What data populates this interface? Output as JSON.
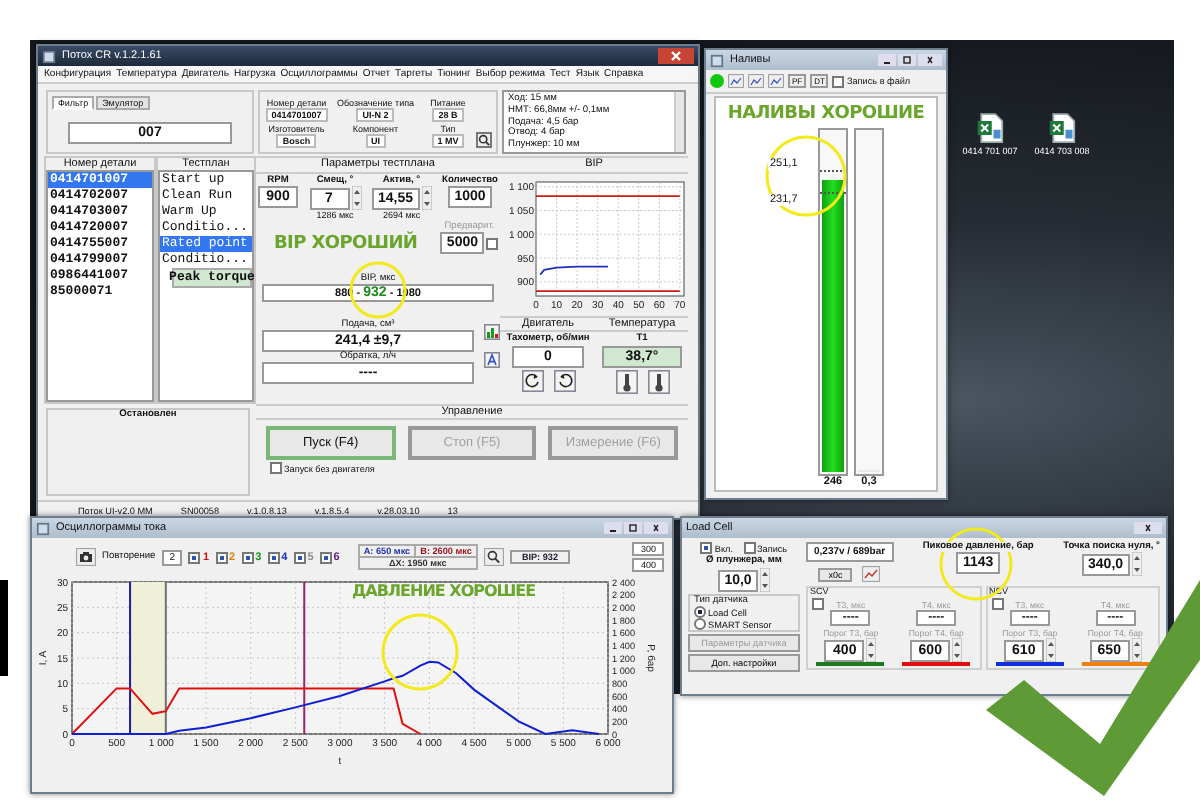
{
  "desktop": {
    "icons": [
      {
        "label": "0414 701 007"
      },
      {
        "label": "0414 703 008"
      }
    ]
  },
  "main": {
    "title": "Потох CR v.1.2.1.61",
    "menu": [
      "Конфигурация",
      "Температура",
      "Двигатель",
      "Нагрузка",
      "Осциллограммы",
      "Отчет",
      "Таргеты",
      "Тюнинг",
      "Выбор режима",
      "Тест",
      "Язык",
      "Справка"
    ],
    "tabs": [
      {
        "label": "Фильтр",
        "selected": true
      },
      {
        "label": "Эмулятор",
        "selected": false
      }
    ],
    "filter": {
      "value": "007"
    },
    "info": [
      {
        "label": "Номер детали",
        "value": "0414701007"
      },
      {
        "label": "Обозначение типа",
        "value": "UI-N 2"
      },
      {
        "label": "Питание",
        "value": "28 В"
      },
      {
        "label": "Изготовитель",
        "value": "Bosch"
      },
      {
        "label": "Компонент",
        "value": "UI"
      },
      {
        "label": "Тип",
        "value": "1 MV"
      }
    ],
    "notes": [
      "Ход: 15 мм",
      "НМТ: 66,8мм +/- 0,1мм",
      "Подача: 4,5 бар",
      "Отвод: 4 бар",
      "Плунжер: 10 мм"
    ],
    "parts": {
      "header": "Номер детали",
      "items": [
        {
          "label": "0414701007",
          "selected": true
        },
        {
          "label": "0414702007",
          "selected": false
        },
        {
          "label": "0414703007",
          "selected": false
        },
        {
          "label": "0414720007",
          "selected": false
        },
        {
          "label": "0414755007",
          "selected": false
        },
        {
          "label": "0414799007",
          "selected": false
        },
        {
          "label": "0986441007",
          "selected": false
        },
        {
          "label": "85000071",
          "selected": false
        }
      ]
    },
    "testplan": {
      "header": "Тестплан",
      "items": [
        {
          "label": "Start up",
          "selected": false,
          "current": false
        },
        {
          "label": "Clean Run",
          "selected": false,
          "current": false
        },
        {
          "label": "Warm Up",
          "selected": false,
          "current": false
        },
        {
          "label": "Conditio...",
          "selected": false,
          "current": false
        },
        {
          "label": "Rated point",
          "selected": true,
          "current": false
        },
        {
          "label": "Conditio...",
          "selected": false,
          "current": false
        },
        {
          "label": "Peak torque",
          "selected": false,
          "current": true
        }
      ]
    },
    "params": {
      "header": "Параметры тестплана",
      "fields": [
        {
          "label": "RPM",
          "value": "900",
          "spinner": false
        },
        {
          "label": "Смещ, °",
          "value": "7",
          "spinner": true,
          "note": "1286 мкс"
        },
        {
          "label": "Актив, °",
          "value": "14,55",
          "spinner": true,
          "note": "2694 мкс"
        },
        {
          "label": "Количество",
          "value": "1000",
          "spinner": false
        }
      ],
      "preheat": {
        "label": "Предварит.",
        "value": "5000",
        "checked": false
      }
    },
    "stamp": "ВІР ХОРОШИЙ",
    "bip": {
      "label": "ВІР, мкс",
      "parts": [
        {
          "text": "880 - ",
          "kind": "limit"
        },
        {
          "text": "932",
          "kind": "measured"
        },
        {
          "text": " - 1080",
          "kind": "limit"
        }
      ]
    },
    "bip_chart": {
      "header": "ВІР",
      "chart_data": {
        "type": "line",
        "grid": true,
        "x": [
          0,
          2,
          4,
          10,
          20,
          30,
          35,
          70
        ],
        "xlim": [
          0,
          72
        ],
        "ylim": [
          870,
          1110
        ],
        "xticks": [
          0,
          10,
          20,
          30,
          40,
          50,
          60,
          70
        ],
        "yticks": [
          {
            "value": 900,
            "label": "900"
          },
          {
            "value": 950,
            "label": "950"
          },
          {
            "value": 1000,
            "label": "1 000"
          },
          {
            "value": 1050,
            "label": "1 050"
          },
          {
            "value": 1100,
            "label": "1 100"
          }
        ],
        "series": [
          {
            "color": "#d01818",
            "values": [
              1080,
              1080,
              1080,
              1080,
              1080,
              1080,
              1080,
              1080
            ]
          },
          {
            "color": "#d01818",
            "values": [
              880,
              880,
              880,
              880,
              880,
              880,
              880,
              880
            ]
          },
          {
            "color": "#2030c0",
            "values": [
              null,
              915,
              925,
              930,
              932,
              932,
              932,
              null
            ]
          }
        ]
      }
    },
    "feed": {
      "label": "Подача, см³",
      "value": "241,4 ±9,7"
    },
    "return": {
      "label": "Обратка, л/ч",
      "value": "----"
    },
    "engine": {
      "header": "Двигатель",
      "label": "Тахометр, об/мин",
      "value": "0"
    },
    "temperature": {
      "header": "Температура",
      "label": "T1",
      "value": "38,7°"
    },
    "state": "Остановлен",
    "control": {
      "header": "Управление",
      "buttons": [
        {
          "label": "Пуск (F4)",
          "disabled": false
        },
        {
          "label": "Стоп (F5)",
          "disabled": true
        },
        {
          "label": "Измерение (F6)",
          "disabled": true
        }
      ],
      "no_engine": {
        "label": "Запуск без двигателя",
        "checked": false
      }
    },
    "status_bar": [
      "Поток UI-v2.0 MM",
      "SN00058",
      "v.1.0.8.13",
      "v.1.8.5.4",
      "v.28.03.10",
      "13"
    ]
  },
  "nalivy": {
    "title": "Наливы",
    "toolbar_buttons": [
      "PF",
      "DT"
    ],
    "record": {
      "label": "Запись в файл",
      "checked": false
    },
    "stamp": "НАЛИВЫ ХОРОШИЕ",
    "limits": [
      "251,1",
      "231,7"
    ],
    "bars": [
      {
        "level": 0.86,
        "reading": "246"
      },
      {
        "level": 0,
        "reading": "0,3"
      }
    ]
  },
  "scope": {
    "title": "Осциллограммы тока",
    "repeat": {
      "label": "Повторение",
      "value": "2"
    },
    "channels": [
      {
        "label": "1",
        "checked": true,
        "color": "#d01010"
      },
      {
        "label": "2",
        "checked": true,
        "color": "#e08000"
      },
      {
        "label": "3",
        "checked": true,
        "color": "#109010"
      },
      {
        "label": "4",
        "checked": true,
        "color": "#1030c0"
      },
      {
        "label": "5",
        "checked": true,
        "color": "#888888"
      },
      {
        "label": "6",
        "checked": true,
        "color": "#602080"
      }
    ],
    "cursor_a": "A: 650 мкс",
    "cursor_b": "B: 2600 мкс",
    "delta": "ΔX: 1950 мкс",
    "bip": "ВІР: 932",
    "side_values": [
      "300",
      "400"
    ],
    "stamp": "ДАВЛЕНИЕ ХОРОШЕЕ",
    "chart_data": {
      "type": "line",
      "grid": true,
      "xlabel": "t",
      "ylabel": "I, A",
      "y2label": "P, бар",
      "xlim": [
        0,
        6000
      ],
      "ylim": [
        0,
        30
      ],
      "y2lim": [
        0,
        2400
      ],
      "xticks": [
        0,
        500,
        {
          "value": 1000,
          "label": "1 000"
        },
        {
          "value": 1500,
          "label": "1 500"
        },
        {
          "value": 2000,
          "label": "2 000"
        },
        {
          "value": 2500,
          "label": "2 500"
        },
        {
          "value": 3000,
          "label": "3 000"
        },
        {
          "value": 3500,
          "label": "3 500"
        },
        {
          "value": 4000,
          "label": "4 000"
        },
        {
          "value": 4500,
          "label": "4 500"
        },
        {
          "value": 5000,
          "label": "5 000"
        },
        {
          "value": 5500,
          "label": "5 500"
        },
        {
          "value": 6000,
          "label": "6 000"
        }
      ],
      "yticks": [
        0,
        5,
        10,
        15,
        20,
        25,
        30
      ],
      "y2ticks": [
        0,
        200,
        400,
        600,
        800,
        {
          "value": 1000,
          "label": "1 000"
        },
        {
          "value": 1200,
          "label": "1 200"
        },
        {
          "value": 1400,
          "label": "1 400"
        },
        {
          "value": 1600,
          "label": "1 600"
        },
        {
          "value": 1800,
          "label": "1 800"
        },
        {
          "value": 2000,
          "label": "2 000"
        },
        {
          "value": 2200,
          "label": "2 200"
        },
        {
          "value": 2400,
          "label": "2 400"
        }
      ],
      "x": [
        0,
        500,
        650,
        900,
        1050,
        1200,
        1500,
        2000,
        2500,
        3000,
        3500,
        3600,
        3700,
        3900,
        4000,
        4100,
        4300,
        4500,
        5000,
        5300,
        5600,
        5900
      ],
      "series": [
        {
          "color": "#e01010",
          "values": [
            0,
            9,
            9,
            4,
            4.5,
            9,
            9,
            9,
            9,
            9,
            9,
            9,
            2,
            0,
            null,
            null,
            null,
            null,
            null,
            null,
            null,
            null
          ]
        },
        {
          "color": "#1020d0",
          "axis": "y2",
          "values": [
            0,
            0,
            0,
            0,
            0,
            50,
            100,
            250,
            420,
            600,
            830,
            880,
            920,
            1080,
            1140,
            1130,
            960,
            700,
            200,
            0,
            60,
            0
          ]
        }
      ],
      "bands": [
        {
          "axis": "x",
          "from": 650,
          "to": 1050
        }
      ],
      "ref_lines": [
        {
          "axis": "x",
          "value": 650,
          "color": "#1a1a9c"
        },
        {
          "axis": "x",
          "value": 1050,
          "color": "#707070"
        },
        {
          "axis": "x",
          "value": 2600,
          "color": "#a0206a"
        }
      ]
    }
  },
  "load_cell": {
    "title": "Load Cell",
    "enable": {
      "label": "Вкл.",
      "checked": true
    },
    "record": {
      "label": "Запись",
      "checked": false
    },
    "plunger": {
      "label": "Ø плунжера, мм",
      "value": "10,0"
    },
    "sensor": {
      "label": "Тип датчика",
      "options": [
        {
          "label": "Load Cell",
          "selected": true
        },
        {
          "label": "SMART Sensor",
          "selected": false
        }
      ]
    },
    "buttons": [
      {
        "label": "Параметры датчика",
        "disabled": true
      },
      {
        "label": "Доп. настройки",
        "disabled": false
      }
    ],
    "reading": "0,237v / 689bar",
    "zero_button": "x0c",
    "peak": {
      "label": "Пиковое давление, бар",
      "value": "1143"
    },
    "zero_point": {
      "label": "Точка поиска нуля, °",
      "value": "340,0"
    },
    "groups": [
      {
        "name": "SCV",
        "checked": false,
        "t3_label": "T3, мкс",
        "t3": "----",
        "t4_label": "T4, мкс",
        "t4": "----",
        "thresholds": [
          {
            "label": "Порог T3, бар",
            "value": "400",
            "color": "#1e7a1e"
          },
          {
            "label": "Порог T4, бар",
            "value": "600",
            "color": "#e01010"
          }
        ]
      },
      {
        "name": "NCV",
        "checked": false,
        "t3_label": "T3, мкс",
        "t3": "----",
        "t4_label": "T4, мкс",
        "t4": "----",
        "thresholds": [
          {
            "label": "Порог T3, бар",
            "value": "610",
            "color": "#1030e0"
          },
          {
            "label": "Порог T4, бар",
            "value": "650",
            "color": "#f08010"
          }
        ]
      }
    ]
  }
}
